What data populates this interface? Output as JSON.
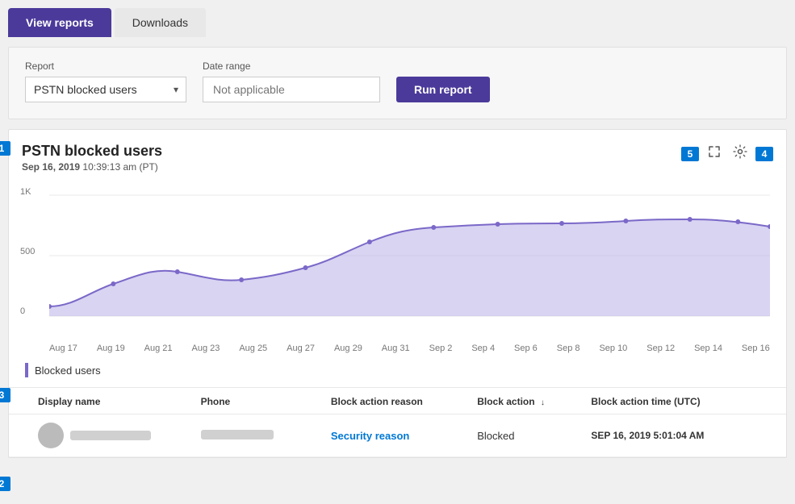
{
  "tabs": [
    {
      "id": "view-reports",
      "label": "View reports",
      "active": true
    },
    {
      "id": "downloads",
      "label": "Downloads",
      "active": false
    }
  ],
  "filter": {
    "report_label": "Report",
    "report_value": "PSTN blocked users",
    "report_highlight": "PSTN",
    "date_range_label": "Date range",
    "date_range_placeholder": "Not applicable",
    "run_button_label": "Run report"
  },
  "report": {
    "title": "PSTN blocked users",
    "subtitle_date": "Sep 16, 2019",
    "subtitle_time": "10:39:13 am (PT)",
    "badge1": "1",
    "badge2": "2",
    "badge3": "3",
    "badge4": "4",
    "badge5": "5",
    "y_labels": [
      "1K",
      "500",
      "0"
    ],
    "x_labels": [
      "Aug 17",
      "Aug 19",
      "Aug 21",
      "Aug 23",
      "Aug 25",
      "Aug 27",
      "Aug 29",
      "Aug 31",
      "Sep 2",
      "Sep 4",
      "Sep 6",
      "Sep 8",
      "Sep 10",
      "Sep 12",
      "Sep 14",
      "Sep 16"
    ],
    "legend_label": "Blocked users",
    "table": {
      "columns": [
        {
          "id": "display-name",
          "label": "Display name"
        },
        {
          "id": "phone",
          "label": "Phone"
        },
        {
          "id": "block-action-reason",
          "label": "Block action reason"
        },
        {
          "id": "block-action",
          "label": "Block action",
          "sortable": true,
          "sort_dir": "desc"
        },
        {
          "id": "block-action-time",
          "label": "Block action time (UTC)"
        }
      ],
      "rows": [
        {
          "display_name": "",
          "phone": "",
          "block_action_reason": "Security reason",
          "block_action": "Blocked",
          "block_action_time": "SEP 16, 2019 5:01:04 AM"
        }
      ]
    }
  }
}
